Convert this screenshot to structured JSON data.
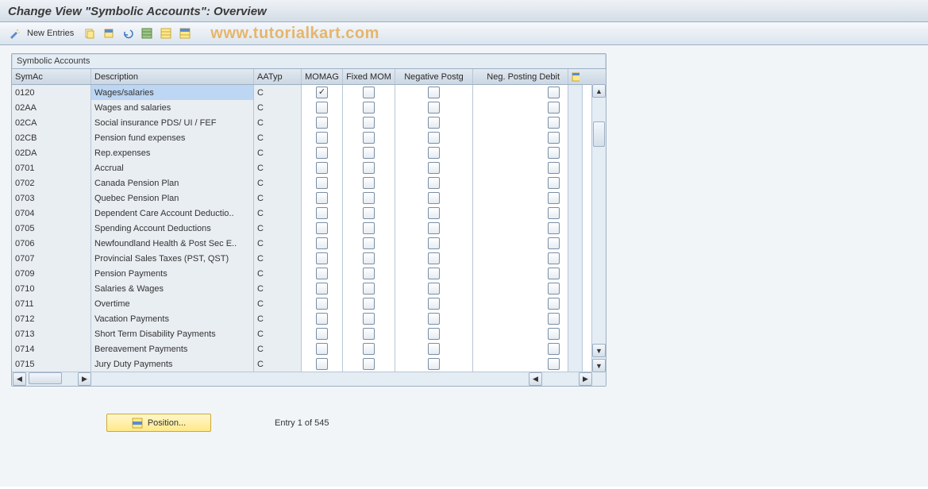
{
  "header": {
    "title": "Change View \"Symbolic Accounts\": Overview"
  },
  "toolbar": {
    "new_entries_label": "New Entries",
    "icons": [
      "wand",
      "copy",
      "select-block",
      "undo",
      "select-all",
      "save",
      "delete-selection",
      "table-settings"
    ]
  },
  "watermark": "www.tutorialkart.com",
  "panel": {
    "title": "Symbolic Accounts",
    "columns": {
      "symac": "SymAc",
      "desc": "Description",
      "aatyp": "AATyp",
      "momag": "MOMAG",
      "fixed": "Fixed MOM",
      "neg": "Negative Postg",
      "negd": "Neg. Posting Debit"
    },
    "rows": [
      {
        "sym": "0120",
        "desc": "Wages/salaries",
        "aat": "C",
        "momag": true,
        "fix": false,
        "neg": false,
        "negd": false,
        "selected": true
      },
      {
        "sym": "02AA",
        "desc": "Wages and salaries",
        "aat": "C",
        "momag": false,
        "fix": false,
        "neg": false,
        "negd": false
      },
      {
        "sym": "02CA",
        "desc": "Social insurance PDS/ UI / FEF",
        "aat": "C",
        "momag": false,
        "fix": false,
        "neg": false,
        "negd": false
      },
      {
        "sym": "02CB",
        "desc": "Pension fund expenses",
        "aat": "C",
        "momag": false,
        "fix": false,
        "neg": false,
        "negd": false
      },
      {
        "sym": "02DA",
        "desc": "Rep.expenses",
        "aat": "C",
        "momag": false,
        "fix": false,
        "neg": false,
        "negd": false
      },
      {
        "sym": "0701",
        "desc": "Accrual",
        "aat": "C",
        "momag": false,
        "fix": false,
        "neg": false,
        "negd": false
      },
      {
        "sym": "0702",
        "desc": "Canada Pension Plan",
        "aat": "C",
        "momag": false,
        "fix": false,
        "neg": false,
        "negd": false
      },
      {
        "sym": "0703",
        "desc": "Quebec Pension Plan",
        "aat": "C",
        "momag": false,
        "fix": false,
        "neg": false,
        "negd": false
      },
      {
        "sym": "0704",
        "desc": "Dependent Care Account Deductio..",
        "aat": "C",
        "momag": false,
        "fix": false,
        "neg": false,
        "negd": false
      },
      {
        "sym": "0705",
        "desc": "Spending Account Deductions",
        "aat": "C",
        "momag": false,
        "fix": false,
        "neg": false,
        "negd": false
      },
      {
        "sym": "0706",
        "desc": "Newfoundland Health & Post Sec E..",
        "aat": "C",
        "momag": false,
        "fix": false,
        "neg": false,
        "negd": false
      },
      {
        "sym": "0707",
        "desc": "Provincial Sales Taxes (PST, QST)",
        "aat": "C",
        "momag": false,
        "fix": false,
        "neg": false,
        "negd": false
      },
      {
        "sym": "0709",
        "desc": "Pension Payments",
        "aat": "C",
        "momag": false,
        "fix": false,
        "neg": false,
        "negd": false
      },
      {
        "sym": "0710",
        "desc": "Salaries & Wages",
        "aat": "C",
        "momag": false,
        "fix": false,
        "neg": false,
        "negd": false
      },
      {
        "sym": "0711",
        "desc": "Overtime",
        "aat": "C",
        "momag": false,
        "fix": false,
        "neg": false,
        "negd": false
      },
      {
        "sym": "0712",
        "desc": "Vacation Payments",
        "aat": "C",
        "momag": false,
        "fix": false,
        "neg": false,
        "negd": false
      },
      {
        "sym": "0713",
        "desc": "Short Term Disability Payments",
        "aat": "C",
        "momag": false,
        "fix": false,
        "neg": false,
        "negd": false
      },
      {
        "sym": "0714",
        "desc": "Bereavement Payments",
        "aat": "C",
        "momag": false,
        "fix": false,
        "neg": false,
        "negd": false
      },
      {
        "sym": "0715",
        "desc": "Jury Duty Payments",
        "aat": "C",
        "momag": false,
        "fix": false,
        "neg": false,
        "negd": false
      }
    ]
  },
  "footer": {
    "position_button": "Position...",
    "entry_text": "Entry 1 of 545"
  }
}
